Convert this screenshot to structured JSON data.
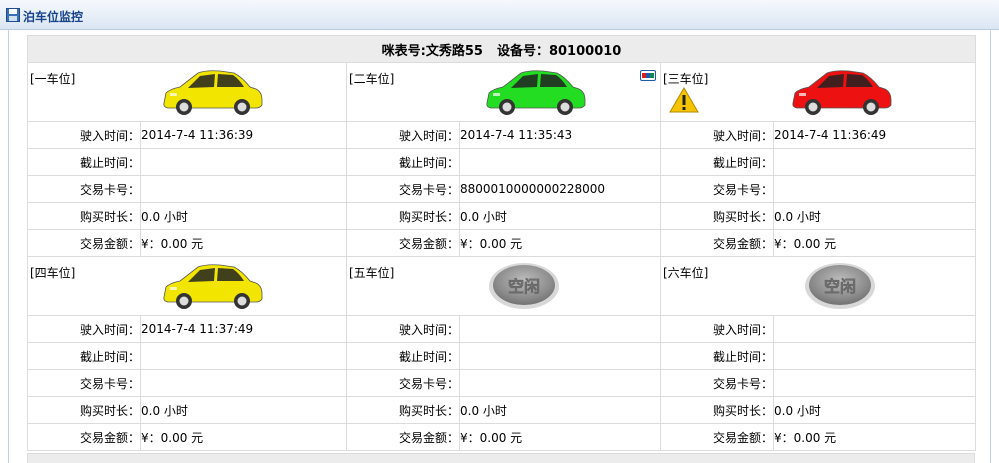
{
  "window": {
    "title": "泊车位监控"
  },
  "header": {
    "meter_text": "咪表号:文秀路55",
    "device_text": "设备号：80100010"
  },
  "labels": {
    "entry_time": "驶入时间：",
    "end_time": "截止时间：",
    "card_no": "交易卡号：",
    "duration": "购买时长：",
    "amount": "交易金额："
  },
  "spots": [
    {
      "label": "[一车位]",
      "car_color": "#f2e600",
      "status_icon": "car-icon",
      "entry_time": "2014-7-4 11:36:39",
      "end_time": "",
      "card_no": "",
      "duration": "0.0 小时",
      "amount": "¥：0.00 元"
    },
    {
      "label": "[二车位]",
      "car_color": "#22dd22",
      "status_icon": "car-icon",
      "extra_icon": "credit-card-icon",
      "entry_time": "2014-7-4 11:35:43",
      "end_time": "",
      "card_no": "8800010000000228000",
      "duration": "0.0 小时",
      "amount": "¥：0.00 元"
    },
    {
      "label": "[三车位]",
      "car_color": "#ee1111",
      "status_icon": "car-icon",
      "extra_icon": "warning-icon",
      "entry_time": "2014-7-4 11:36:49",
      "end_time": "",
      "card_no": "",
      "duration": "0.0 小时",
      "amount": "¥：0.00 元"
    },
    {
      "label": "[四车位]",
      "car_color": "#f2e600",
      "status_icon": "car-icon",
      "entry_time": "2014-7-4 11:37:49",
      "end_time": "",
      "card_no": "",
      "duration": "0.0 小时",
      "amount": "¥：0.00 元"
    },
    {
      "label": "[五车位]",
      "status_icon": "empty-spot-icon",
      "badge_text": "空闲",
      "entry_time": "",
      "end_time": "",
      "card_no": "",
      "duration": "0.0 小时",
      "amount": "¥：0.00 元"
    },
    {
      "label": "[六车位]",
      "status_icon": "empty-spot-icon",
      "badge_text": "空闲",
      "entry_time": "",
      "end_time": "",
      "card_no": "",
      "duration": "0.0 小时",
      "amount": "¥：0.00 元"
    }
  ]
}
